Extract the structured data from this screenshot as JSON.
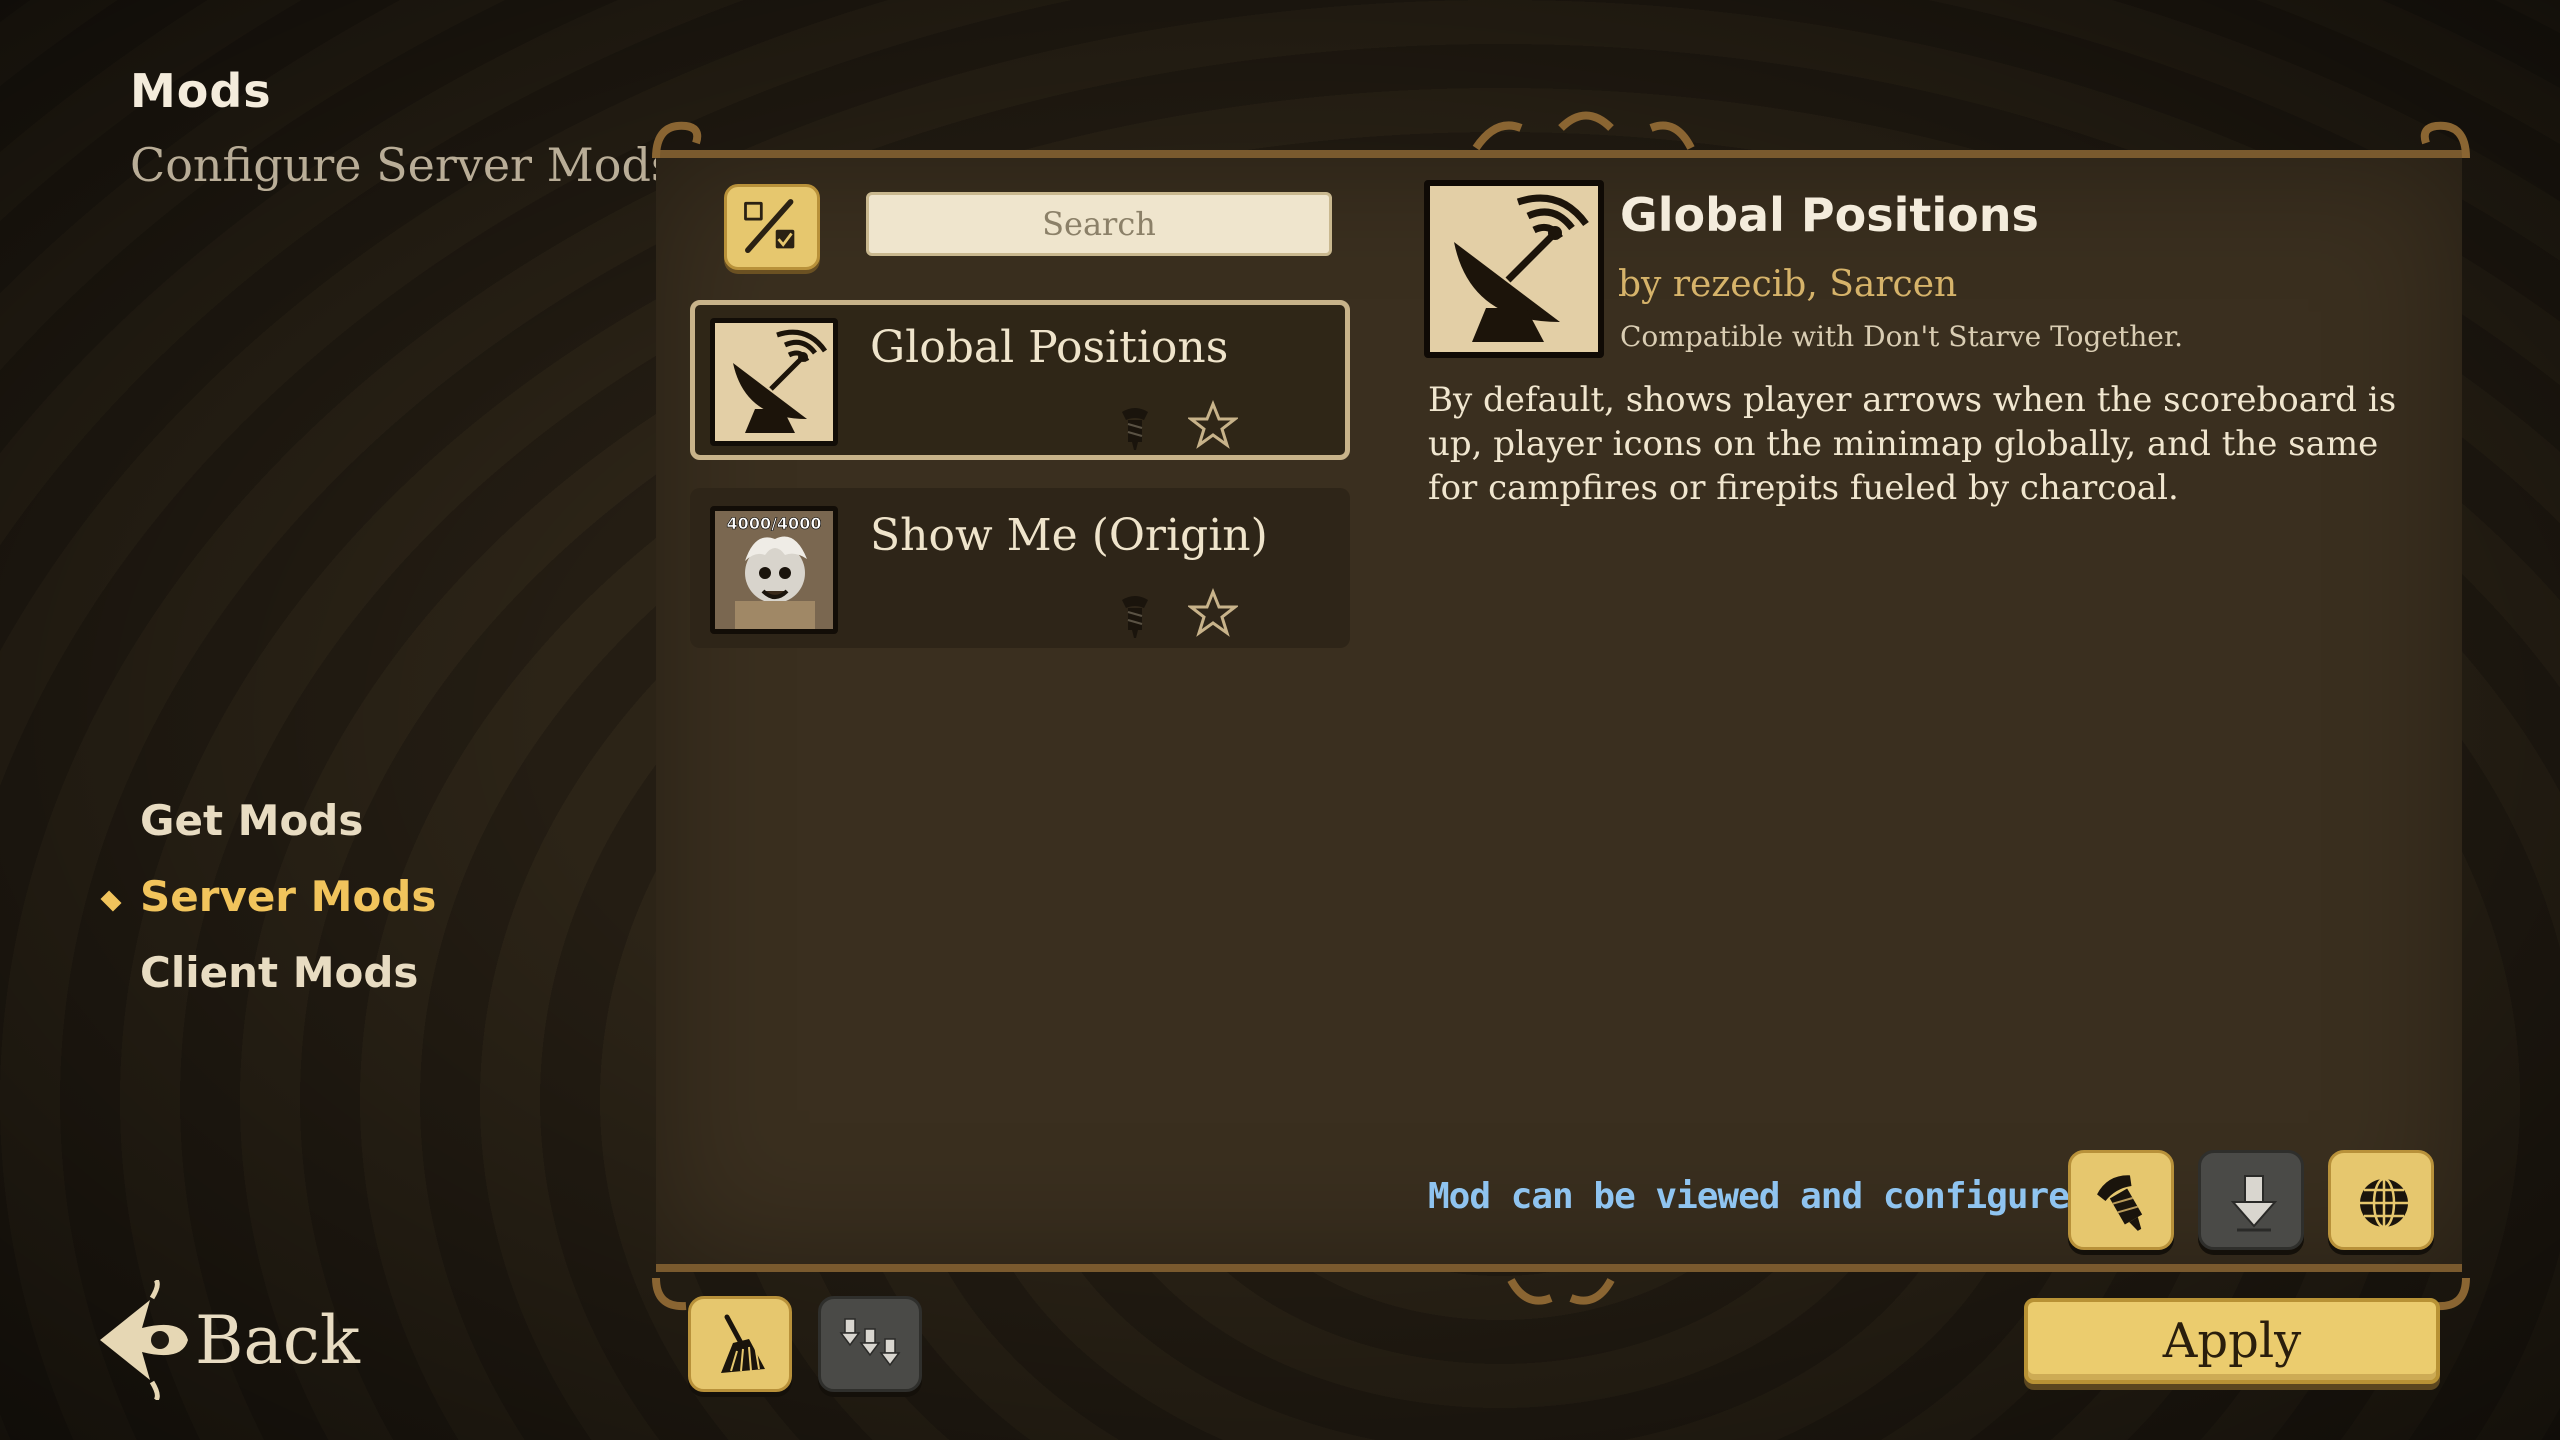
{
  "header": {
    "title": "Mods",
    "subtitle": "Configure Server Mods"
  },
  "nav": {
    "items": [
      {
        "label": "Get Mods",
        "active": false
      },
      {
        "label": "Server Mods",
        "active": true
      },
      {
        "label": "Client Mods",
        "active": false
      }
    ],
    "back_label": "Back"
  },
  "search": {
    "placeholder": "Search"
  },
  "mod_list": [
    {
      "name": "Global Positions",
      "selected": true,
      "icon": "satellite-dish-icon"
    },
    {
      "name": "Show Me (Origin)",
      "selected": false,
      "icon": "show-me-character-icon",
      "thumb_text": "4000/4000"
    }
  ],
  "detail": {
    "title": "Global Positions",
    "author": "by rezecib, Sarcen",
    "compat": "Compatible with Don't Starve Together.",
    "description": "By default, shows player arrows when the scoreboard is up, player icons on the minimap globally, and the same for campfires or firepits fueled by charcoal.",
    "status": "Mod can be viewed and configured."
  },
  "actions": {
    "configure_icon": "bolt-icon",
    "update_icon": "download-icon",
    "workshop_icon": "globe-icon",
    "cleanup_icon": "broom-icon",
    "update_all_icon": "update-all-icon",
    "apply_label": "Apply"
  },
  "colors": {
    "accent": "#f1c45c",
    "button_gold": "#e6c76e",
    "status_blue": "#8fc4f0",
    "panel": "#3a2f1f"
  }
}
